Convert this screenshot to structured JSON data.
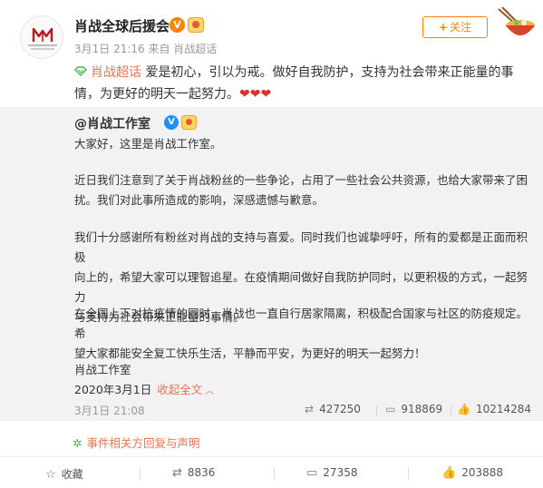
{
  "post": {
    "username": "肖战全球后援会",
    "verified_mark": "V",
    "meta": "3月1日 21:16 来自 肖战超话",
    "follow_label": "关注",
    "follow_plus": "+",
    "topic": "肖战超话",
    "text_line1": "爱是初心，引以为戒。做好自我防护，支持为社会带来正能量的事",
    "text_line2": "情，为更好的明天一起努力。",
    "hearts": "❤❤❤"
  },
  "repost": {
    "author": "@肖战工作室",
    "verified_mark": "V",
    "p1": "大家好，这里是肖战工作室。",
    "p2_l1": "近日我们注意到了关于肖战粉丝的一些争论，占用了一些社会公共资源，也给大家带来了困",
    "p2_l2": "扰。我们对此事所造成的影响，深感遗憾与歉意。",
    "p3_l1": "我们十分感谢所有粉丝对肖战的支持与喜爱。同时我们也诚挚呼吁，所有的爱都是正面而积极",
    "p3_l2": "向上的，希望大家可以理智追星。在疫情期间做好自我防护同时，以更积极的方式，一起努力",
    "p3_l3": "与支持为社会带来正能量的事情。",
    "p4_l1": "在全国上下对抗疫情的同时，肖战也一直自行居家隔离，积极配合国家与社区的防疫规定。希",
    "p4_l2": "望大家都能安全复工快乐生活，平静而平安，为更好的明天一起努力！",
    "signature": "肖战工作室",
    "date": "2020年3月1日",
    "collapse_label": "收起全文",
    "time": "3月1日 21:08",
    "reposts": "427250",
    "comments": "918869",
    "likes": "10214284"
  },
  "event_link": "事件相关方回复与声明",
  "actions": {
    "favorite": "收藏",
    "repost": "8836",
    "comment": "27358",
    "like": "203888"
  },
  "icons": {
    "topic": "diamond-topic-icon",
    "event": "pinwheel-icon",
    "favorite": "star-icon",
    "repost": "repost-arrows-icon",
    "comment": "comment-bubble-icon",
    "like": "thumbs-up-icon"
  },
  "colors": {
    "accent": "#ff8200",
    "link": "#eb7350",
    "repost_bg": "#f2f2f5",
    "heart": "#e32b2b"
  }
}
